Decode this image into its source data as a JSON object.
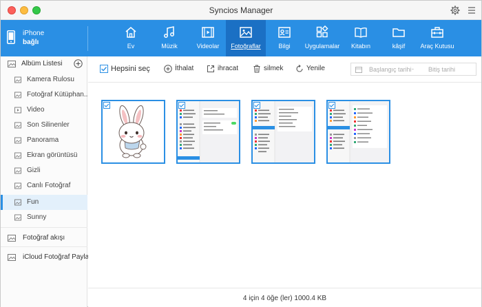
{
  "window": {
    "title": "Syncios Manager"
  },
  "device": {
    "name": "iPhone",
    "status": "bağlı"
  },
  "nav": [
    {
      "label": "Ev",
      "icon": "home-icon"
    },
    {
      "label": "Müzik",
      "icon": "music-icon"
    },
    {
      "label": "Videolar",
      "icon": "video-icon"
    },
    {
      "label": "Fotoğraflar",
      "icon": "photo-icon"
    },
    {
      "label": "Bilgi",
      "icon": "contact-card-icon"
    },
    {
      "label": "Uygulamalar",
      "icon": "apps-icon"
    },
    {
      "label": "Kitabın",
      "icon": "book-icon"
    },
    {
      "label": "kâşif",
      "icon": "folder-icon"
    },
    {
      "label": "Araç Kutusu",
      "icon": "toolbox-icon"
    }
  ],
  "nav_active": "Fotoğraflar",
  "sidebar": {
    "header": "Albüm Listesi",
    "albums": [
      {
        "label": "Kamera Rulosu"
      },
      {
        "label": "Fotoğraf Kütüphan..."
      },
      {
        "label": "Video"
      },
      {
        "label": "Son Silinenler"
      },
      {
        "label": "Panorama"
      },
      {
        "label": "Ekran görüntüsü"
      },
      {
        "label": "Gizli"
      },
      {
        "label": "Canlı Fotoğraf"
      },
      {
        "label": "Fun"
      },
      {
        "label": "Sunny"
      }
    ],
    "active_album": "Fun",
    "photo_stream": "Fotoğraf akışı",
    "icloud_share": "iCloud Fotoğraf Payla..."
  },
  "toolbar": {
    "select_all": "Hepsini seç",
    "import": "İthalat",
    "export": "ihracat",
    "delete": "silmek",
    "refresh": "Yenile",
    "date_start_placeholder": "Başlangıç tarihi",
    "date_separator": "-",
    "date_end_placeholder": "Bitiş tarihi"
  },
  "photos": [
    {
      "kind": "bunny-sticker",
      "selected": true
    },
    {
      "kind": "ipad-settings-screenshot",
      "selected": true
    },
    {
      "kind": "ipad-settings-screenshot",
      "selected": true
    },
    {
      "kind": "ipad-settings-screenshot",
      "selected": true
    }
  ],
  "status": "4 için 4 öğe (ler) 1000.4 KB",
  "colors": {
    "accent": "#2a8fe4",
    "accent_dark": "#1b70c4",
    "selection": "#e3f0fb"
  }
}
